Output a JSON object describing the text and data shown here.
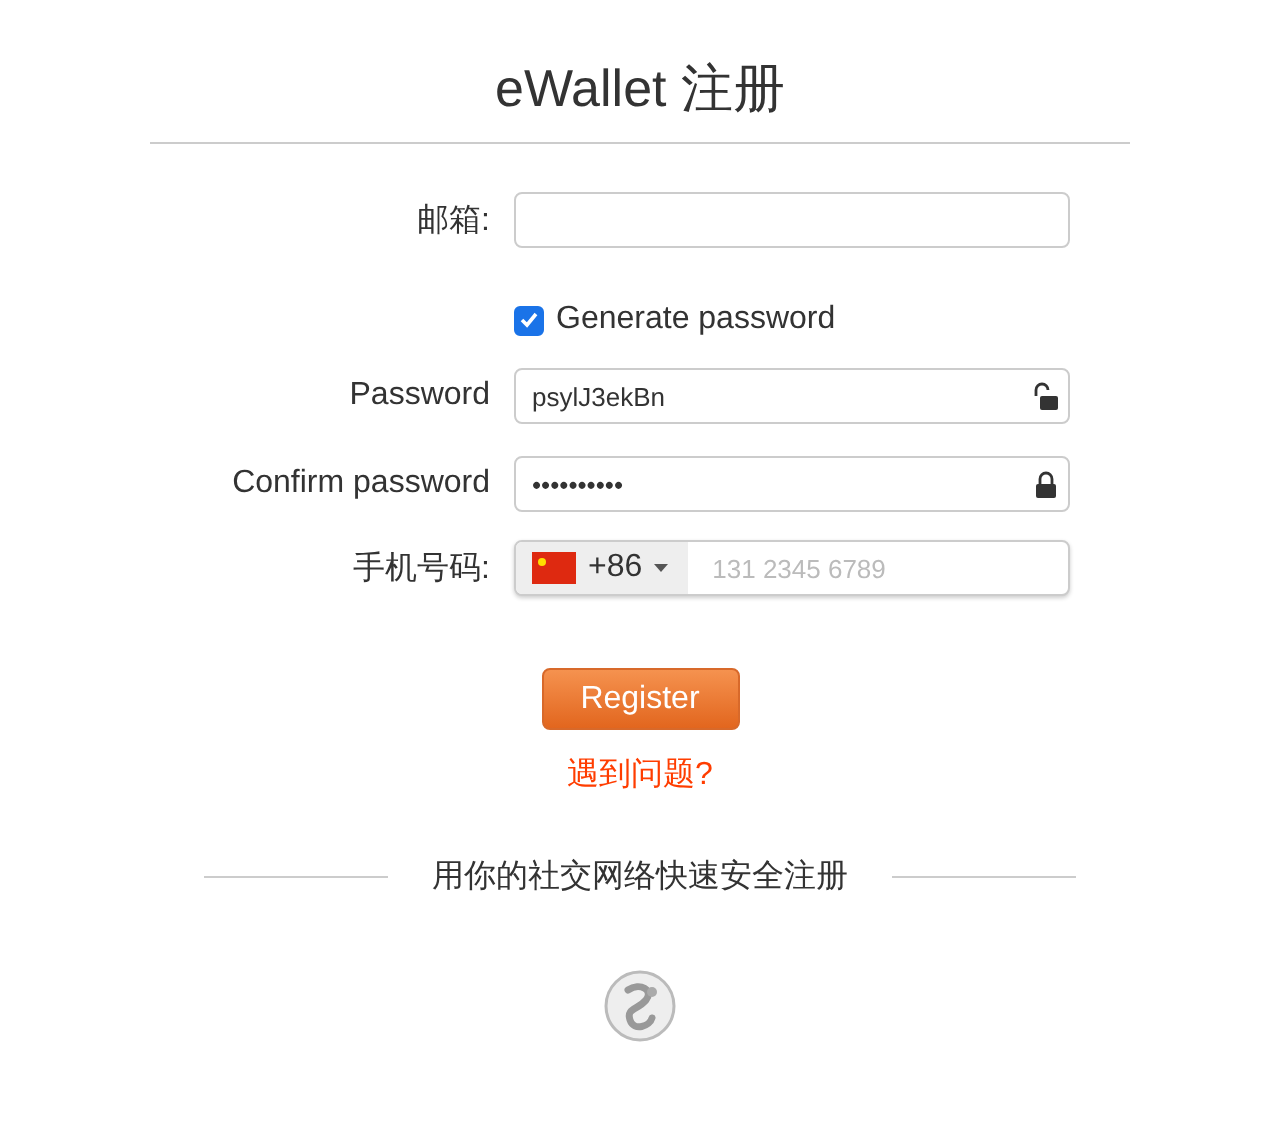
{
  "title": "eWallet 注册",
  "email": {
    "label": "邮箱:"
  },
  "generate_password": {
    "label": "Generate password",
    "checked": true
  },
  "password": {
    "label": "Password",
    "value": "psylJ3ekBn",
    "locked": false
  },
  "confirm_password": {
    "label": "Confirm password",
    "value": "••••••••••",
    "locked": true
  },
  "phone": {
    "label": "手机号码:",
    "country_code": "+86",
    "placeholder": "131 2345 6789"
  },
  "register_button": "Register",
  "help_link": "遇到问题?",
  "social_divider": "用你的社交网络快速安全注册"
}
